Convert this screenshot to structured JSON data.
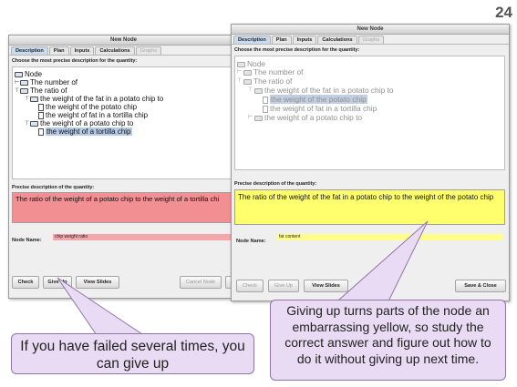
{
  "slide_number": "24",
  "left_window": {
    "title": "New Node",
    "tabs": [
      "Description",
      "Plan",
      "Inputs",
      "Calculations",
      "Graphs"
    ],
    "prompt": "Choose the most precise description for the quantity:",
    "tree": {
      "root": "Node",
      "items": [
        "The number of",
        "The ratio of",
        "the weight of the fat in a potato chip to",
        "the weight of the potato chip",
        "the weight of fat in a tortilla chip",
        "the weight of a potato chip to",
        "the weight of a tortilla chip"
      ]
    },
    "precise_label": "Precise description of the quantity:",
    "precise_text": "The ratio of the weight of a potato chip to the weight of a tortilla chi",
    "node_name_label": "Node Name:",
    "node_name_value": "chip weight ratio",
    "buttons": {
      "check": "Check",
      "give_up": "Give Up",
      "view_slides": "View Slides",
      "cancel_node": "Cancel Node"
    }
  },
  "right_window": {
    "title": "New Node",
    "tabs": [
      "Description",
      "Plan",
      "Inputs",
      "Calculations",
      "Graphs"
    ],
    "prompt": "Choose the most precise description for the quantity:",
    "tree": {
      "root": "Node",
      "items": [
        "The number of",
        "The ratio of",
        "the weight of the fat in a potato chip to",
        "the weight of the potato chip",
        "the weight of fat in a tortilla chip",
        "the weight of a potato chip to"
      ]
    },
    "precise_label": "Precise description of the quantity:",
    "precise_text": "The ratio of the weight of the fat in a potato chip to the weight of the potato chip",
    "node_name_label": "Node Name:",
    "node_name_value": "fat content",
    "buttons": {
      "check": "Check",
      "give_up": "Give Up",
      "view_slides": "View Slides",
      "save_close": "Save & Close"
    }
  },
  "callouts": {
    "left": "If you have failed several times, you can give up",
    "right": "Giving up turns parts of the node an embarrassing yellow, so study the correct answer and figure out how to do it without giving up next time."
  },
  "colors": {
    "red_box": "#f28f92",
    "red_field": "#f4a7ab",
    "yellow_box": "#ffff6e",
    "yellow_field": "#ffff8a",
    "callout_bg": "#e9dbf3"
  }
}
